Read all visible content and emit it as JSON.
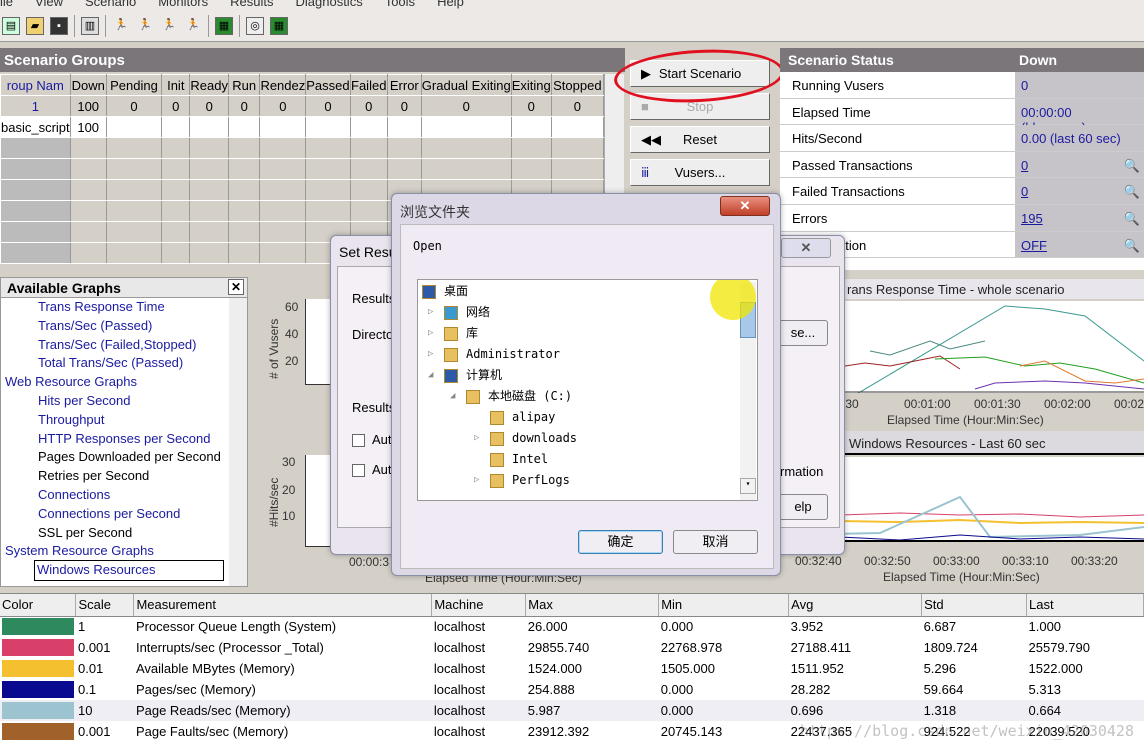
{
  "menu": [
    "ile",
    "View",
    "Scenario",
    "Monitors",
    "Results",
    "Diagnostics",
    "Tools",
    "Help"
  ],
  "scenario_groups": {
    "title": "Scenario Groups",
    "columns": [
      "roup Nam",
      "Down",
      "Pending",
      "Init",
      "Ready",
      "Run",
      "Rendez",
      "Passed",
      "Failed",
      "Error",
      "Gradual Exiting",
      "Exiting",
      "Stopped"
    ],
    "totals": [
      "1",
      "100",
      "0",
      "0",
      "0",
      "0",
      "0",
      "0",
      "0",
      "0",
      "0",
      "0",
      "0"
    ],
    "rows": [
      [
        "basic_script",
        "100",
        "",
        "",
        "",
        "",
        "",
        "",
        "",
        "",
        "",
        "",
        ""
      ]
    ]
  },
  "buttons": {
    "start": "Start Scenario",
    "stop": "Stop",
    "reset": "Reset",
    "vusers": "Vusers..."
  },
  "scenario_status": {
    "title": "Scenario Status",
    "state": "Down",
    "rows": [
      {
        "label": "Running Vusers",
        "value": "0",
        "link": false,
        "zoom": false
      },
      {
        "label": "Elapsed Time",
        "value": "00:00:00 (hh:mm:ss)",
        "link": false,
        "zoom": false
      },
      {
        "label": "Hits/Second",
        "value": "0.00 (last 60 sec)",
        "link": false,
        "zoom": false
      },
      {
        "label": "Passed Transactions",
        "value": "0",
        "link": true,
        "zoom": true
      },
      {
        "label": "Failed Transactions",
        "value": "0",
        "link": true,
        "zoom": true
      },
      {
        "label": "Errors",
        "value": "195",
        "link": true,
        "zoom": true
      },
      {
        "label": "Virtualization",
        "value": "OFF",
        "link": true,
        "zoom": true
      }
    ]
  },
  "available_graphs": {
    "title": "Available Graphs",
    "items": [
      {
        "label": "Trans Response Time",
        "level": 1,
        "avail": true
      },
      {
        "label": "Trans/Sec (Passed)",
        "level": 1,
        "avail": true
      },
      {
        "label": "Trans/Sec (Failed,Stopped)",
        "level": 1,
        "avail": true
      },
      {
        "label": "Total Trans/Sec (Passed)",
        "level": 1,
        "avail": true
      },
      {
        "label": "Web Resource Graphs",
        "level": 0,
        "avail": true
      },
      {
        "label": "Hits per Second",
        "level": 1,
        "avail": true
      },
      {
        "label": "Throughput",
        "level": 1,
        "avail": true
      },
      {
        "label": "HTTP Responses per Second",
        "level": 1,
        "avail": true
      },
      {
        "label": "Pages Downloaded per Second",
        "level": 1,
        "avail": false
      },
      {
        "label": "Retries per Second",
        "level": 1,
        "avail": false
      },
      {
        "label": "Connections",
        "level": 1,
        "avail": true
      },
      {
        "label": "Connections per Second",
        "level": 1,
        "avail": true
      },
      {
        "label": "SSL per Second",
        "level": 1,
        "avail": false
      },
      {
        "label": "System Resource Graphs",
        "level": 0,
        "avail": true
      },
      {
        "label": "Windows Resources",
        "level": 1,
        "avail": true,
        "selected": true
      }
    ]
  },
  "charts": {
    "vusers": {
      "ylabel": "# of Vusers",
      "yticks": [
        "60",
        "40",
        "20"
      ]
    },
    "hits": {
      "ylabel": "#Hits/sec",
      "yticks": [
        "30",
        "20",
        "10"
      ],
      "xtick": "00:00:3",
      "xlabel": "Elapsed Time (Hour:Min:Sec)"
    },
    "trt": {
      "title": "rans Response Time - whole scenario",
      "xticks": [
        ":30",
        "00:01:00",
        "00:01:30",
        "00:02:00",
        "00:02:30"
      ],
      "xlabel": "Elapsed Time (Hour:Min:Sec)"
    },
    "winres": {
      "title": "Windows Resources - Last 60 sec",
      "xticks": [
        "00:32:40",
        "00:32:50",
        "00:33:00",
        "00:33:10",
        "00:33:20"
      ],
      "xlabel": "Elapsed Time (Hour:Min:Sec)"
    }
  },
  "set_results_dialog": {
    "title": "Set Resu",
    "results1": "Results",
    "directory": "Directo",
    "results2": "Results",
    "auto1": "Aut",
    "auto2": "Aut",
    "browse": "se...",
    "info": "rmation",
    "help": "elp"
  },
  "browse_dialog": {
    "title": "浏览文件夹",
    "prompt": "Open",
    "tree": [
      {
        "label": "桌面",
        "icon": "desktop-icon"
      },
      {
        "label": "网络",
        "icon": "network-icon"
      },
      {
        "label": "库",
        "icon": "library-icon"
      },
      {
        "label": "Administrator",
        "icon": "user-folder-icon"
      },
      {
        "label": "计算机",
        "icon": "computer-icon"
      },
      {
        "label": "本地磁盘 (C:)",
        "icon": "drive-icon"
      },
      {
        "label": "alipay",
        "icon": "folder-icon"
      },
      {
        "label": "downloads",
        "icon": "folder-icon"
      },
      {
        "label": "Intel",
        "icon": "folder-icon"
      },
      {
        "label": "PerfLogs",
        "icon": "folder-icon"
      }
    ],
    "ok": "确定",
    "cancel": "取消"
  },
  "measurements": {
    "columns": [
      "Color",
      "Scale",
      "Measurement",
      "Machine",
      "Max",
      "Min",
      "Avg",
      "Std",
      "Last"
    ],
    "rows": [
      {
        "color": "#2e8a5e",
        "scale": "1",
        "name": "Processor Queue Length (System)",
        "machine": "localhost",
        "max": "26.000",
        "min": "0.000",
        "avg": "3.952",
        "std": "6.687",
        "last": "1.000"
      },
      {
        "color": "#d8406a",
        "scale": "0.001",
        "name": "Interrupts/sec (Processor _Total)",
        "machine": "localhost",
        "max": "29855.740",
        "min": "22768.978",
        "avg": "27188.411",
        "std": "1809.724",
        "last": "25579.790"
      },
      {
        "color": "#f5c030",
        "scale": "0.01",
        "name": "Available MBytes (Memory)",
        "machine": "localhost",
        "max": "1524.000",
        "min": "1505.000",
        "avg": "1511.952",
        "std": "5.296",
        "last": "1522.000"
      },
      {
        "color": "#0a0a90",
        "scale": "0.1",
        "name": "Pages/sec (Memory)",
        "machine": "localhost",
        "max": "254.888",
        "min": "0.000",
        "avg": "28.282",
        "std": "59.664",
        "last": "5.313"
      },
      {
        "color": "#9cc4d0",
        "scale": "10",
        "name": "Page Reads/sec (Memory)",
        "machine": "localhost",
        "max": "5.987",
        "min": "0.000",
        "avg": "0.696",
        "std": "1.318",
        "last": "0.664"
      },
      {
        "color": "#a0622a",
        "scale": "0.001",
        "name": "Page Faults/sec (Memory)",
        "machine": "localhost",
        "max": "23912.392",
        "min": "20745.143",
        "avg": "22437.365",
        "std": "924.522",
        "last": "22039.520"
      }
    ]
  },
  "watermark": "https://blog.csdn.net/weixin_42030428"
}
